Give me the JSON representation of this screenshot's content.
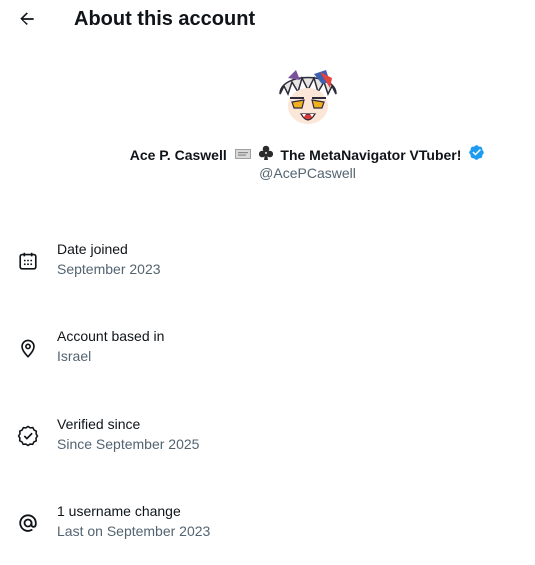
{
  "header": {
    "back_icon": "arrow-left-icon",
    "title": "About this account"
  },
  "profile": {
    "avatar_icon": "vtuber-avatar",
    "name": "Ace P. Caswell",
    "name_emoji_1": "ticket-icon",
    "name_emoji_2": "club-suit-icon",
    "tagline": "The MetaNavigator VTuber!",
    "verified_icon": "verified-badge-icon",
    "handle": "@AcePCaswell",
    "verified_color": "#1d9bf0"
  },
  "info": [
    {
      "icon": "calendar-icon",
      "title": "Date joined",
      "value": "September 2023"
    },
    {
      "icon": "location-icon",
      "title": "Account based in",
      "value": "Israel"
    },
    {
      "icon": "verified-outline-icon",
      "title": "Verified since",
      "value": "Since September 2025"
    },
    {
      "icon": "at-sign-icon",
      "title": "1 username change",
      "value": "Last on September 2023"
    }
  ]
}
